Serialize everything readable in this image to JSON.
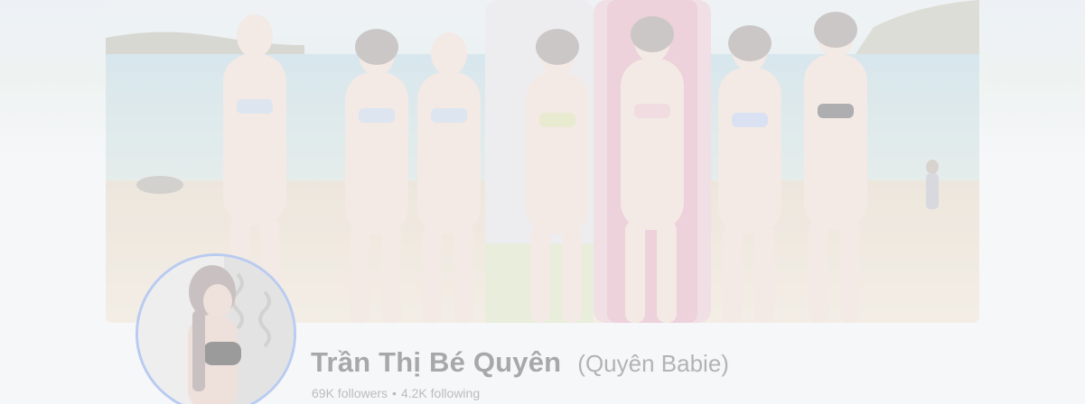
{
  "profile": {
    "name": "Trần Thị Bé Quyên",
    "alternate_name": "(Quyên Babie)",
    "followers": "69K followers",
    "separator": "•",
    "following": "4.2K following"
  },
  "colors": {
    "avatar_ring": "#b9cbf1",
    "name_text": "#a8a8a8",
    "stats_text": "#bcbcbc"
  }
}
